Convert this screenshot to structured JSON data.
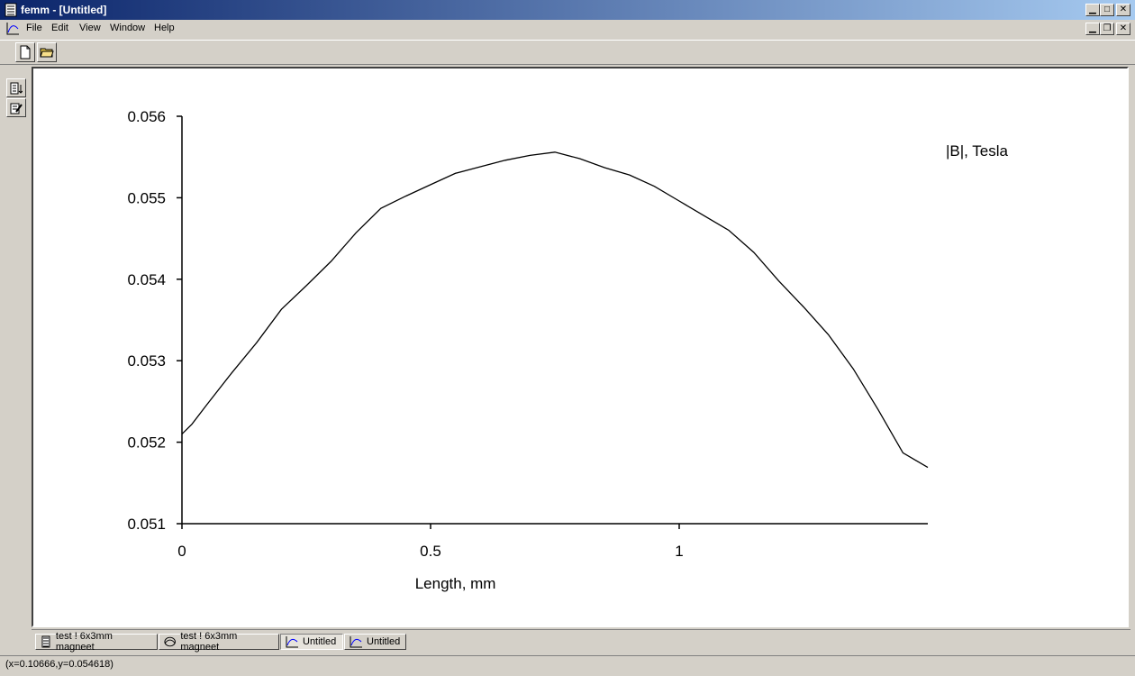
{
  "window": {
    "title": "femm - [Untitled]"
  },
  "menu": {
    "items": [
      "File",
      "Edit",
      "View",
      "Window",
      "Help"
    ]
  },
  "tabs": [
    {
      "label": "test ! 6x3mm magneet",
      "icon": "magnet-doc-icon"
    },
    {
      "label": "test ! 6x3mm magneet",
      "icon": "field-plot-icon"
    },
    {
      "label": "Untitled",
      "icon": "xy-plot-icon"
    },
    {
      "label": "Untitled",
      "icon": "xy-plot-icon"
    }
  ],
  "status": {
    "text": "(x=0.10666,y=0.054618)"
  },
  "chart_data": {
    "type": "line",
    "legend_label": "|B|, Tesla",
    "xlabel": "Length, mm",
    "xlim": [
      0,
      1.5
    ],
    "ylim": [
      0.051,
      0.056
    ],
    "x_ticks": [
      0,
      0.5,
      1
    ],
    "x_tick_labels": [
      "0",
      "0.5",
      "1"
    ],
    "y_ticks": [
      0.051,
      0.052,
      0.053,
      0.054,
      0.055,
      0.056
    ],
    "y_tick_labels": [
      "0.051",
      "0.052",
      "0.053",
      "0.054",
      "0.055",
      "0.056"
    ],
    "series": [
      {
        "x": [
          0,
          0.02,
          0.05,
          0.1,
          0.15,
          0.2,
          0.25,
          0.3,
          0.35,
          0.4,
          0.45,
          0.5,
          0.55,
          0.6,
          0.65,
          0.7,
          0.75,
          0.8,
          0.85,
          0.9,
          0.95,
          1.0,
          1.05,
          1.1,
          1.15,
          1.2,
          1.25,
          1.3,
          1.35,
          1.4,
          1.45,
          1.5
        ],
        "y": [
          0.0521,
          0.05222,
          0.05246,
          0.05285,
          0.05322,
          0.05363,
          0.05392,
          0.05422,
          0.05457,
          0.05487,
          0.05502,
          0.05516,
          0.0553,
          0.05538,
          0.05546,
          0.05552,
          0.05556,
          0.05548,
          0.05537,
          0.05528,
          0.05514,
          0.05496,
          0.05478,
          0.0546,
          0.05433,
          0.05398,
          0.05366,
          0.05332,
          0.0529,
          0.0524,
          0.05187,
          0.05169
        ]
      }
    ]
  }
}
